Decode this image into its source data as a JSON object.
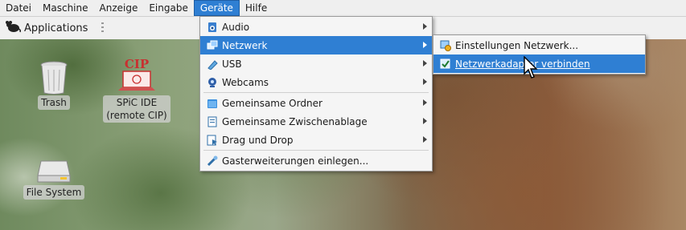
{
  "menubar": {
    "items": [
      "Datei",
      "Maschine",
      "Anzeige",
      "Eingabe",
      "Geräte",
      "Hilfe"
    ],
    "active_index": 4
  },
  "panel": {
    "applications_label": "Applications"
  },
  "desktop": {
    "icons": [
      {
        "label": "Trash",
        "icon": "trash-icon"
      },
      {
        "label_line1": "SPiC IDE",
        "label_line2": "(remote CIP)",
        "icon_text": "CIP",
        "icon": "laptop-icon"
      },
      {
        "label": "File System",
        "icon": "drive-icon"
      }
    ]
  },
  "devices_menu": {
    "items": [
      {
        "label": "Audio",
        "icon": "audio-icon",
        "submenu": true
      },
      {
        "label": "Netzwerk",
        "icon": "network-icon",
        "submenu": true,
        "selected": true
      },
      {
        "label": "USB",
        "icon": "usb-icon",
        "submenu": true
      },
      {
        "label": "Webcams",
        "icon": "webcam-icon",
        "submenu": true
      },
      {
        "label": "Gemeinsame Ordner",
        "icon": "folder-icon",
        "submenu": true
      },
      {
        "label": "Gemeinsame Zwischenablage",
        "icon": "clipboard-icon",
        "submenu": true
      },
      {
        "label": "Drag und Drop",
        "icon": "drag-drop-icon",
        "submenu": true
      },
      {
        "label": "Gasterweiterungen einlegen...",
        "icon": "guest-additions-icon",
        "submenu": false
      }
    ]
  },
  "network_submenu": {
    "items": [
      {
        "label": "Einstellungen Netzwerk...",
        "icon": "network-settings-icon"
      },
      {
        "label": "Netzwerkadapter verbinden",
        "icon": "network-connect-icon",
        "selected": true
      }
    ]
  },
  "colors": {
    "accent": "#2f7fd3",
    "menu_bg": "#f5f5f5"
  }
}
